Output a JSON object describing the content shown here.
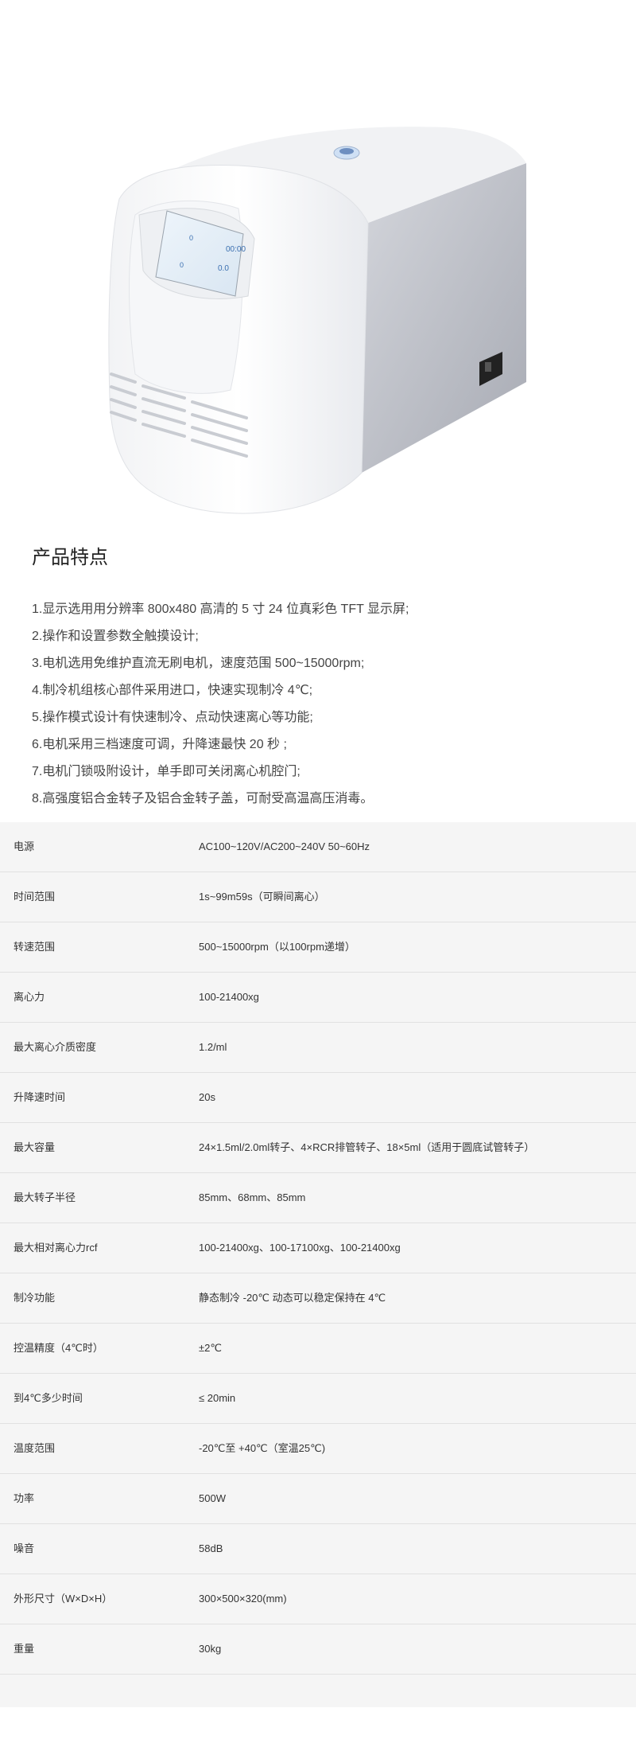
{
  "section_title": "产品特点",
  "features": [
    "1.显示选用用分辨率 800x480 高清的 5 寸 24 位真彩色 TFT 显示屏;",
    "2.操作和设置参数全触摸设计;",
    "3.电机选用免维护直流无刷电机，速度范围 500~15000rpm;",
    "4.制冷机组核心部件采用进口，快速实现制冷 4℃;",
    "5.操作模式设计有快速制冷、点动快速离心等功能;",
    "6.电机采用三档速度可调，升降速最快 20 秒 ;",
    "7.电机门锁吸附设计，单手即可关闭离心机腔门;",
    "8.高强度铝合金转子及铝合金转子盖，可耐受高温高压消毒。"
  ],
  "specs": [
    {
      "label": "电源",
      "value": "AC100~120V/AC200~240V 50~60Hz"
    },
    {
      "label": "时间范围",
      "value": "1s~99m59s（可瞬间离心）"
    },
    {
      "label": "转速范围",
      "value": "500~15000rpm（以100rpm递增）"
    },
    {
      "label": "离心力",
      "value": "100-21400xg"
    },
    {
      "label": "最大离心介质密度",
      "value": "1.2/ml"
    },
    {
      "label": "升降速时间",
      "value": "20s"
    },
    {
      "label": "最大容量",
      "value": "24×1.5ml/2.0ml转子、4×RCR排管转子、18×5ml（适用于圆底试管转子）"
    },
    {
      "label": "最大转子半径",
      "value": "85mm、68mm、85mm"
    },
    {
      "label": "最大相对离心力rcf",
      "value": "100-21400xg、100-17100xg、100-21400xg"
    },
    {
      "label": "制冷功能",
      "value": "静态制冷 -20℃ 动态可以稳定保持在 4℃"
    },
    {
      "label": "控温精度（4℃时）",
      "value": "±2℃"
    },
    {
      "label": "到4℃多少时间",
      "value": "≤ 20min"
    },
    {
      "label": "温度范围",
      "value": "-20℃至 +40℃（室温25℃)"
    },
    {
      "label": "功率",
      "value": "500W"
    },
    {
      "label": "噪音",
      "value": "58dB"
    },
    {
      "label": "外形尺寸（W×D×H）",
      "value": "300×500×320(mm)"
    },
    {
      "label": "重量",
      "value": "30kg"
    }
  ],
  "device_screen": {
    "time": "00:00",
    "value_a": "0",
    "value_b": "0",
    "temp": "0.0"
  }
}
